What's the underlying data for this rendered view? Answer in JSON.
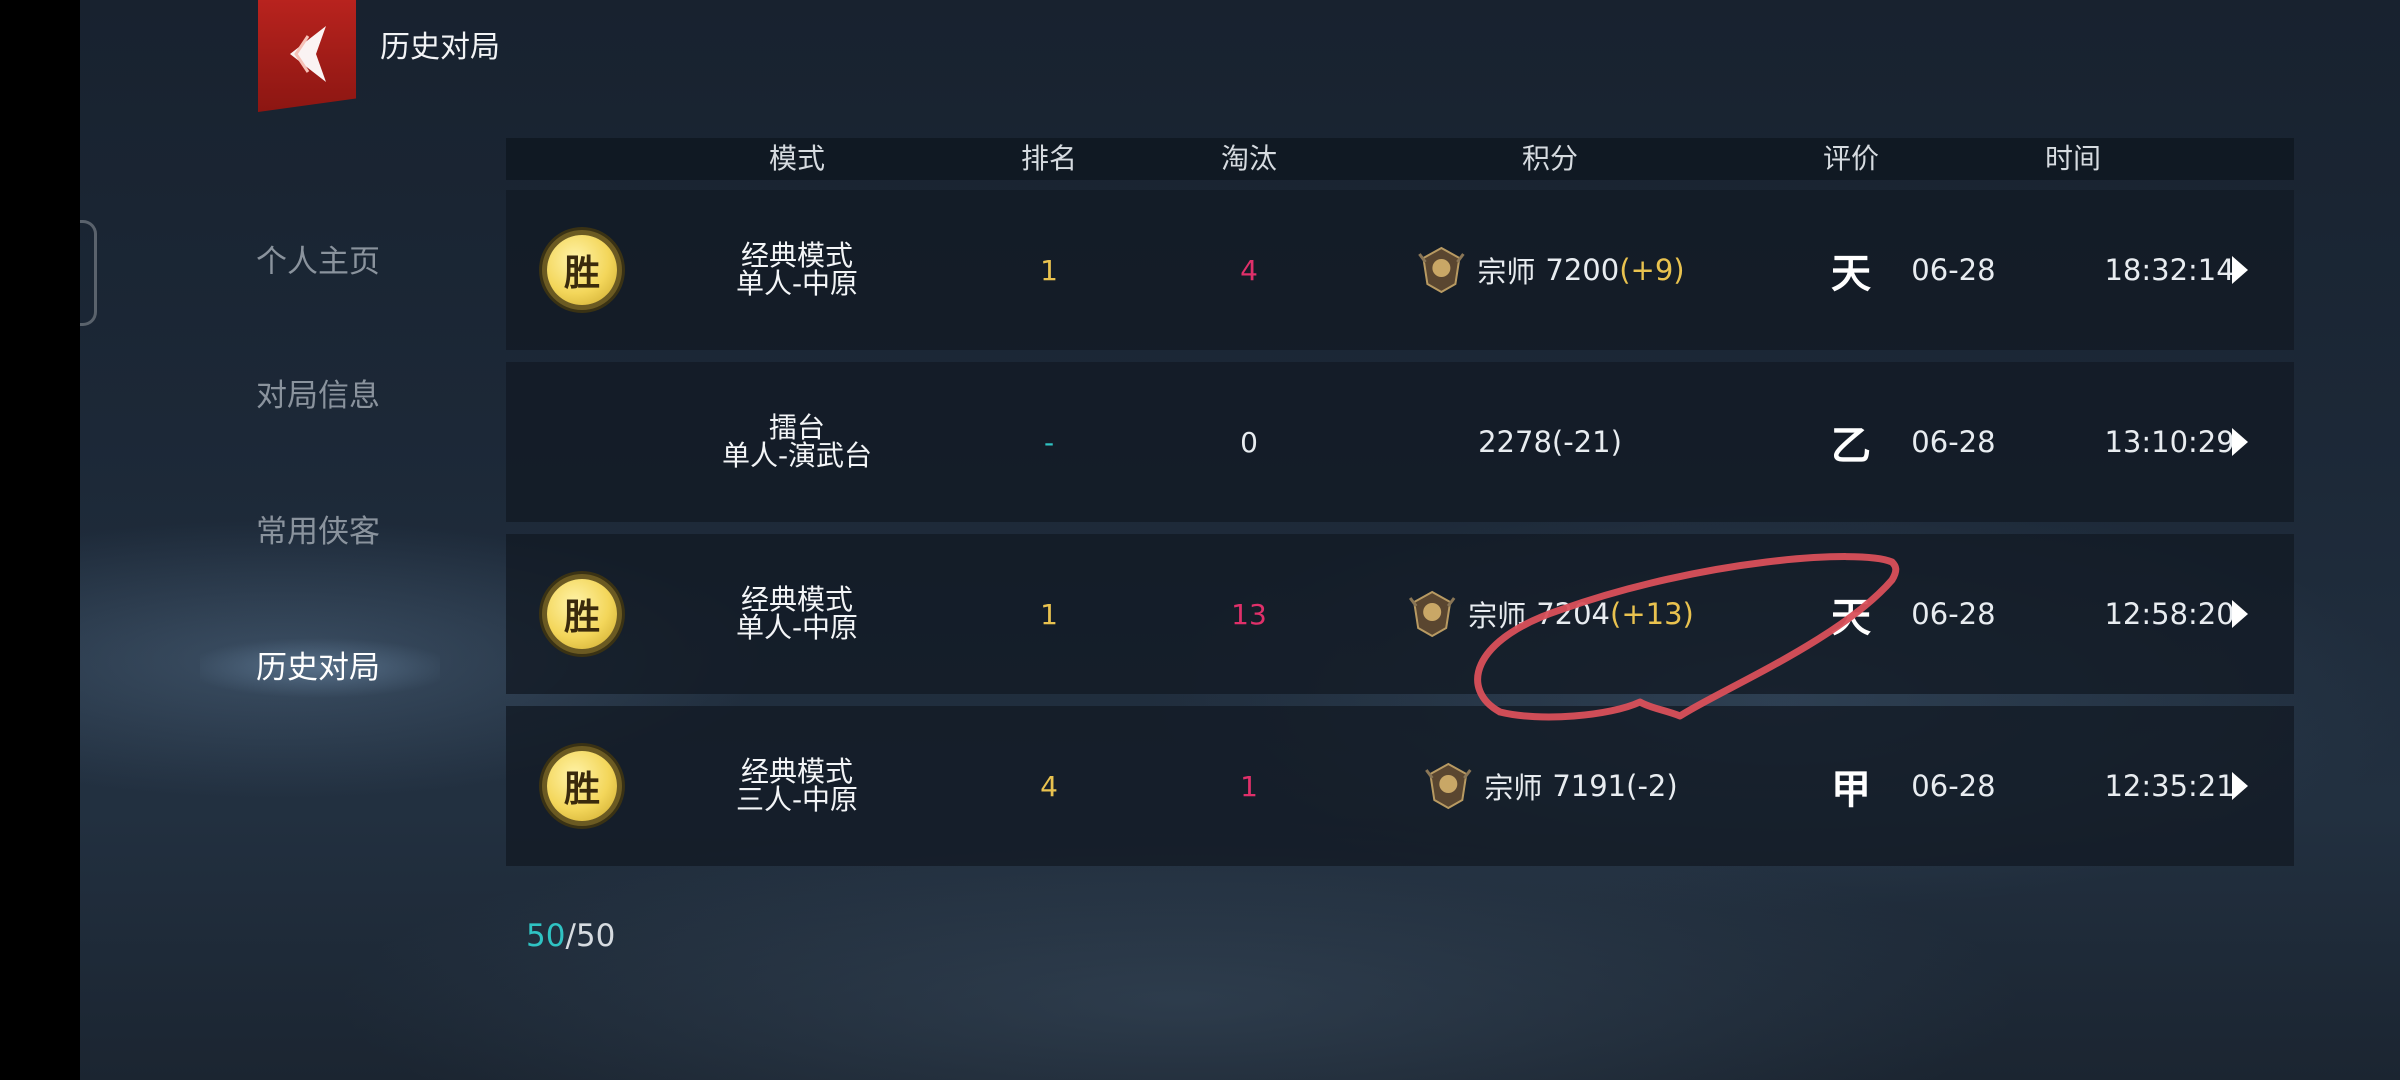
{
  "header": {
    "title": "历史对局"
  },
  "sidebar": {
    "items": [
      {
        "label": "个人主页",
        "active": false
      },
      {
        "label": "对局信息",
        "active": false
      },
      {
        "label": "常用侠客",
        "active": false
      },
      {
        "label": "历史对局",
        "active": true
      }
    ]
  },
  "table": {
    "columns": [
      "模式",
      "排名",
      "淘汰",
      "积分",
      "评价",
      "时间"
    ],
    "rows": [
      {
        "badge": "胜",
        "mode_line1": "经典模式",
        "mode_line2": "单人-中原",
        "rank": "1",
        "eliminations": "4",
        "rank_title": "宗师",
        "score": "7200",
        "delta": "(+9)",
        "grade": "天",
        "date": "06-28",
        "time": "18:32:14"
      },
      {
        "badge": "",
        "mode_line1": "擂台",
        "mode_line2": "单人-演武台",
        "rank": "-",
        "eliminations": "0",
        "rank_title": "",
        "score": "2278",
        "delta": "(-21)",
        "grade": "乙",
        "date": "06-28",
        "time": "13:10:29"
      },
      {
        "badge": "胜",
        "mode_line1": "经典模式",
        "mode_line2": "单人-中原",
        "rank": "1",
        "eliminations": "13",
        "rank_title": "宗师",
        "score": "7204",
        "delta": "(+13)",
        "grade": "天",
        "date": "06-28",
        "time": "12:58:20"
      },
      {
        "badge": "胜",
        "mode_line1": "经典模式",
        "mode_line2": "三人-中原",
        "rank": "4",
        "eliminations": "1",
        "rank_title": "宗师",
        "score": "7191",
        "delta": "(-2)",
        "grade": "甲",
        "date": "06-28",
        "time": "12:35:21"
      }
    ]
  },
  "pager": {
    "current": "50",
    "separator": "/",
    "total": "50"
  },
  "colors": {
    "accent_red": "#b8231e",
    "gold": "#e9c24f",
    "pink": "#e0306a",
    "teal": "#2fc3c3",
    "annotation": "#d9505a"
  },
  "icons": {
    "back": "back-chevron-icon",
    "rank": "grandmaster-rank-icon",
    "row_arrow": "play-arrow-icon"
  }
}
